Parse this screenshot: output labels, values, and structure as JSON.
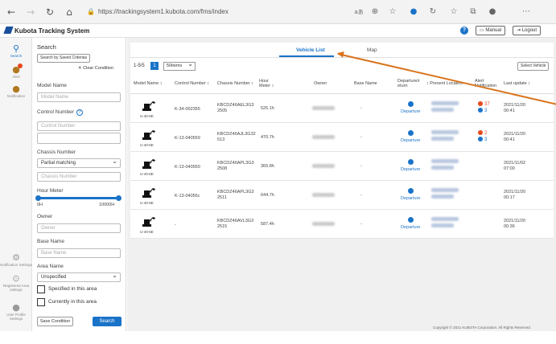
{
  "browser": {
    "url": "https://trackingsystem1.kubota.com/fms/index",
    "reader_label": "aあ"
  },
  "app": {
    "title": "Kubota Tracking System",
    "manual_label": "Manual",
    "logout_label": "Logout"
  },
  "rail": [
    {
      "label": "Search"
    },
    {
      "label": "Alert"
    },
    {
      "label": "Notification"
    },
    {
      "label": "Notification Settings"
    },
    {
      "label": "Registered Area settings"
    },
    {
      "label": "User Profile Settings"
    }
  ],
  "search_panel": {
    "title": "Search",
    "saved_criteria": "Search by Saved Criterias",
    "clear_condition": "Clear Condition",
    "model_name_label": "Model Name",
    "model_name_placeholder": "Model Name",
    "control_number_label": "Control Number",
    "control_number_placeholder": "Control Number",
    "chassis_number_label": "Chassis Number",
    "chassis_match": "Partial matching",
    "chassis_number_placeholder": "Chassis Number",
    "hour_meter_label": "Hour Meter",
    "hour_min": "0H",
    "hour_max": "10000H",
    "owner_label": "Owner",
    "owner_placeholder": "Owner",
    "base_name_label": "Base Name",
    "base_name_placeholder": "Base Name",
    "area_name_label": "Area Name",
    "area_name_value": "Unspecified",
    "specified_area": "Specified in this area",
    "currently_area": "Currently in this area",
    "save_condition": "Save Condition",
    "search": "Search"
  },
  "tabs": {
    "vehicle_list": "Vehicle List",
    "map": "Map"
  },
  "list": {
    "count": "1-5/5",
    "page": "1",
    "per_page": "50items",
    "select_vehicle": "Select Vehicle",
    "headers": {
      "model_name": "Model Name ↕",
      "control_number": "Control Number ↕",
      "chassis_number": "Chassis Number ↕",
      "hour_meter_1": "Hour",
      "hour_meter_2": "Meter ↕",
      "owner": "Owner",
      "base_name": "Base Name",
      "departure_1": "Departure/r",
      "departure_2": "eturn",
      "present_location": "↕ Present Location",
      "alert_1": "Alert",
      "alert_2": "Notification",
      "last_update": "Last update ↕"
    },
    "rows": [
      {
        "model": "U-40-6E",
        "control": "K-34-002355",
        "chassis_1": "KBCDZ46AEL3G3",
        "chassis_2": "2505",
        "hour": "525.1h",
        "base": "-",
        "status": "Departure",
        "alert_red": "37",
        "alert_blue": "3",
        "date": "2021/11/20",
        "time": "00:41"
      },
      {
        "model": "U-40-6E",
        "control": "K-13-040559",
        "chassis_1": "KBCDZ46AJL3G32",
        "chassis_2": "513",
        "hour": "470.7h",
        "base": "-",
        "status": "Departure",
        "alert_red": "2",
        "alert_blue": "3",
        "date": "2021/11/20",
        "time": "00:41"
      },
      {
        "model": "U-40-6E",
        "control": "K-13-040550",
        "chassis_1": "KBCDZ46APL3G3",
        "chassis_2": "2508",
        "hour": "365.8h",
        "base": "-",
        "status": "Departure",
        "alert_red": "",
        "alert_blue": "",
        "date": "2021/11/02",
        "time": "07:00"
      },
      {
        "model": "U-40-6E",
        "control": "K-13-04055c",
        "chassis_1": "KBCDZ46APL3G3",
        "chassis_2": "2511",
        "hour": "644.7h",
        "base": "-",
        "status": "Departure",
        "alert_red": "",
        "alert_blue": "",
        "date": "2021/11/20",
        "time": "00:17"
      },
      {
        "model": "U-40-6E",
        "control": "-",
        "chassis_1": "KBCDZ46AVL3G3",
        "chassis_2": "2515",
        "hour": "587.4h",
        "base": "-",
        "status": "Departure",
        "alert_red": "",
        "alert_blue": "",
        "date": "2021/11/20",
        "time": "00:36"
      }
    ]
  },
  "footer": "Copyright © 2021 KUBOTA Corporation. All Rights Reserved.",
  "colors": {
    "accent": "#1a73c8",
    "alert_red": "#e8481e",
    "annotation_arrow": "#d9741c"
  }
}
